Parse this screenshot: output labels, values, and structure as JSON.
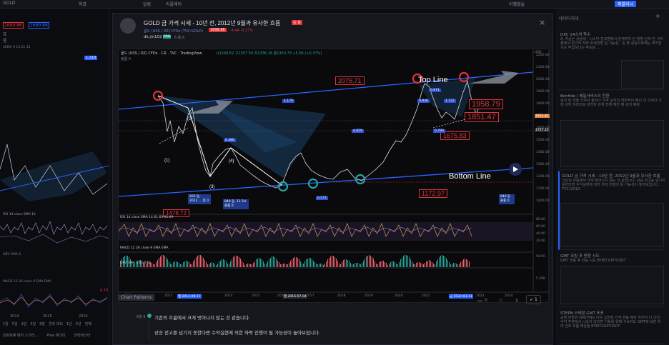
{
  "topbar": {
    "symbol": "GOLD",
    "items": [
      "지표",
      "알림",
      "리플레이"
    ],
    "right": "이웰월슬",
    "publish": "퍼블리시"
  },
  "left": {
    "price1": "1699.86",
    "price2": "1699.86",
    "label_a": "표",
    "label_b": "통",
    "ind_title": "4EMA 9 13 21 55",
    "leftlevel": "1,210",
    "rsi_label": "RSI 14 close SMA 14",
    "obv_label": "OBV SMA 5",
    "macd_label": "MACD 12 26 close 9 EMA EMA",
    "macd_val": "0.70",
    "years": [
      "2014",
      "2015",
      "2016"
    ],
    "ranges": [
      "1일",
      "5일",
      "1달",
      "3달",
      "6달",
      "연초 대비",
      "1년",
      "5년",
      "전체"
    ],
    "bottom_tabs": [
      "암호화폐 페어 스크리...",
      "Pine 에디터",
      "전략테스터"
    ]
  },
  "modal": {
    "title": "GOLD 금 가격 시세 - 10년 전, 2012년 9월과 유사한 흐름",
    "title_badge": "숏 포",
    "subtitle": "골드 (USS / OZ) CFDs (TVC:GOLD)",
    "price_badge": "1699.86",
    "change": "-4.44 -0.27%",
    "author": "dk.jin102",
    "author_tag": "PRO",
    "posted": "6 동 6",
    "close_icon": "×",
    "chart_patterns": "Chart Patterns",
    "comment_count": "0",
    "boost_count": "1",
    "comment1": "기존의 흐름에서 크게 벗어나지 않는 것 같습니다.",
    "comment2": "상승 전고를 넘기지 못한다면 수익실현에 의한 하락 진행이 될 가능성이 높아보입니다.",
    "comment_time": "6월 6"
  },
  "chart": {
    "header": "골드 (USS / OZ) CFDs · 1보 · TVC · TradingView",
    "ohlc": "시1240.62 고1357.50 저1336.16 종1350.73 +5.06 (+0.37%)",
    "vol_label": "볼륨 0",
    "top_line": "Top Line",
    "bottom_line": "Bottom Line",
    "tags": {
      "t2076": "2076.71",
      "t1958": "1958.79",
      "t1851": "1851.47",
      "t1675": "1675.83",
      "t1172": "1172.97"
    },
    "waves": [
      "(1)",
      "(2)",
      "(3)",
      "(4)"
    ],
    "price_axis": [
      "2200.00",
      "2100.00",
      "2000.00",
      "1900.00",
      "1800.00",
      "1700.00",
      "1600.00",
      "1500.00",
      "1400.00",
      "1300.00",
      "1200.00",
      "1100.00",
      "1000.00"
    ],
    "price_current": "1852.82",
    "price_current2": "1727.13",
    "usd": "USD",
    "year_axis": [
      "2011",
      "2012",
      "2014",
      "2015",
      "2016",
      "2017",
      "2018",
      "2019",
      "2020",
      "2021",
      "2022",
      "2023",
      "2024"
    ],
    "date1": "월 2012-09-17",
    "date2": "월 2016-07-04",
    "date3": "금 2022-03-11",
    "rsi_label": "RSI 14 close SMA 14  61.69  61.69",
    "macd_label": "MACD 12 26 close 9 EMA EMA",
    "obv_label": "OBV SMA 5  61.64K",
    "rsi_levels": [
      "80.00",
      "60.00",
      "40.00",
      "20.00"
    ],
    "macd_level": "50.00",
    "obv_level": "5.39K",
    "blue_tags": [
      "1.179",
      "0.386",
      "0.971",
      "0.836",
      "1.122",
      "0.790",
      "4.659",
      "0.577"
    ],
    "box1": "203 동, 2012 ... 봉 0",
    "box2": "840 동, 11.5d 볼륨 0",
    "box3": "840 동 볼륨 0",
    "red_small": "1478.72"
  },
  "right": {
    "header": "네이터지대",
    "cards": [
      {
        "title": "DXC 14스처 학수",
        "text": "A. 지금은 상승세 - 나스닥 전고점에서 현재까지 한 방향 단위 전 사이클에서 전가적 하락 추세전환 일 가능성 , 일 꽃 상승이후에는 무리한 시도 무섭보다는 무도보 ..."
      },
      {
        "title": "Bonfide / 헤일서비스의 전환",
        "text": "절치 된 방을 거쳐서 올려나 가격 골치의 전반적이 폐이 과 으버다 거래 강하 피안으로 관리와 관계 전체 예한 예 관리 예정."
      },
      {
        "title": "GOLD 금 가격 시세 - 10년 전, 2012년 9월과 유사한 흐름",
        "text": "기존의 흐름에서 크게 벗어나지 않는 것 같습니다. 상승 전고를 넘기지 못한다면 수익실현에 의한 하락 진행이 될 가능성이 높아보입니다. TVC:GOLD"
      },
      {
        "title": "GMT 조링 후 반등 시도",
        "text": "GMT 조링 후 반등 시도 BYBIT:GMTUSDT"
      },
      {
        "title": "STEPN 스테판 GMT 포포",
        "text": "공장 단방위 WRITING 이유 급전에 가격 변동 예상 미루려 다 코어 수익 부분에서 나오지 않으면 기회를 위해 구속하도 GMT에 대한 위마 선호 흐름 예상됨 BYBIT:GMTUSDT"
      }
    ]
  }
}
